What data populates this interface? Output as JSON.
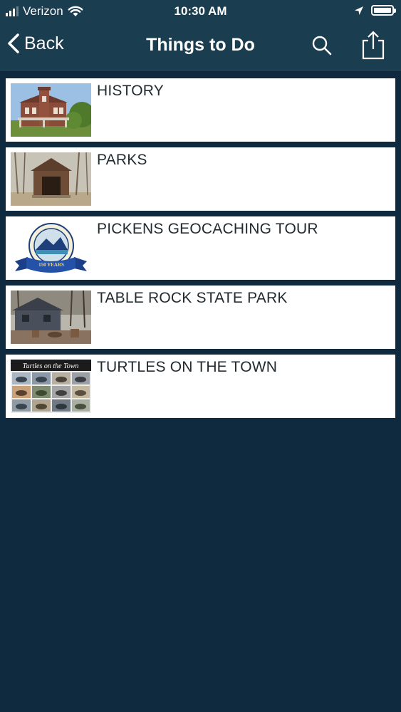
{
  "status_bar": {
    "carrier": "Verizon",
    "time": "10:30 AM"
  },
  "nav": {
    "back_label": "Back",
    "title": "Things to Do"
  },
  "items": [
    {
      "label": "HISTORY"
    },
    {
      "label": "PARKS"
    },
    {
      "label": "PICKENS GEOCACHING TOUR",
      "thumb_text": "150 YEARS"
    },
    {
      "label": "TABLE ROCK STATE PARK"
    },
    {
      "label": "TURTLES ON THE TOWN",
      "thumb_text": "Turtles on the Town"
    }
  ],
  "colors": {
    "background": "#0f2a3e",
    "bar": "#1b3d50",
    "row": "#ffffff",
    "row_text": "#222b30"
  }
}
